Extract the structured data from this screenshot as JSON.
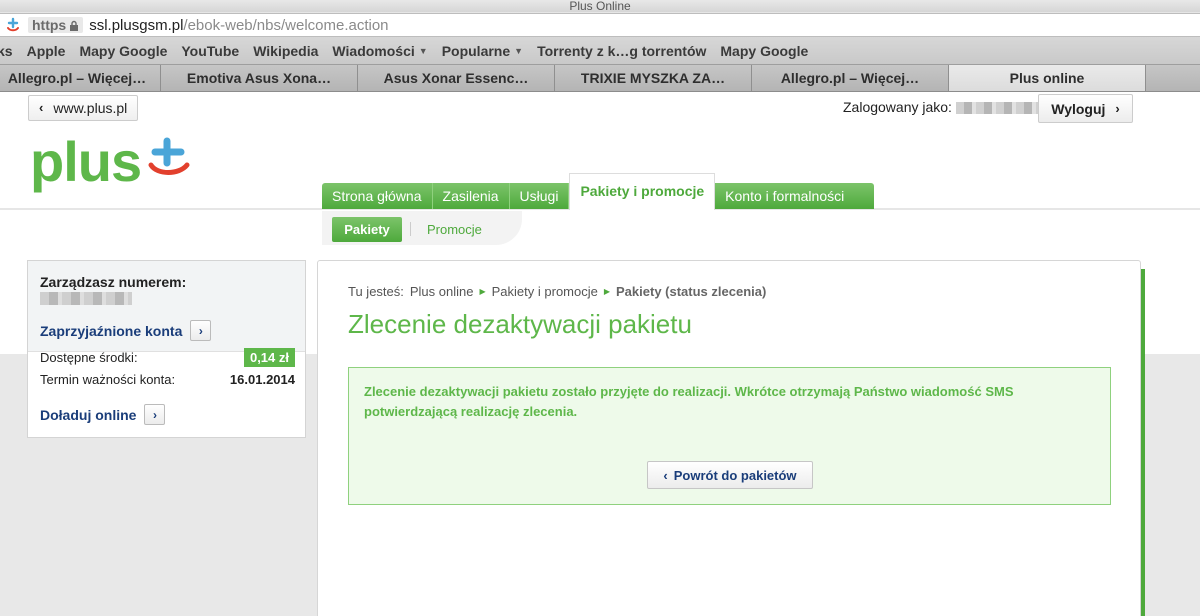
{
  "browser": {
    "title": "Plus Online",
    "url_scheme": "https",
    "url_host": "ssl.plusgsm.pl",
    "url_path": "/ebok-web/nbs/welcome.action",
    "bookmarks": [
      "ks",
      "Apple",
      "Mapy Google",
      "YouTube",
      "Wikipedia",
      "Wiadomości",
      "Popularne",
      "Torrenty z k…g torrentów",
      "Mapy Google"
    ],
    "tabs": [
      {
        "label": "Allegro.pl – Więcej…",
        "active": false
      },
      {
        "label": "Emotiva Asus Xona…",
        "active": false
      },
      {
        "label": "Asus Xonar Essenc…",
        "active": false
      },
      {
        "label": "TRIXIE MYSZKA ZA…",
        "active": false
      },
      {
        "label": "Allegro.pl – Więcej…",
        "active": false
      },
      {
        "label": "Plus online",
        "active": true
      }
    ]
  },
  "header": {
    "back_link": "www.plus.pl",
    "logged_as": "Zalogowany jako:",
    "logout": "Wyloguj",
    "logo": "plus"
  },
  "nav": {
    "main": [
      "Strona główna",
      "Zasilenia",
      "Usługi",
      "Pakiety i promocje",
      "Konto i formalności"
    ],
    "active": "Pakiety i promocje",
    "sub": [
      "Pakiety",
      "Promocje"
    ]
  },
  "sidebar": {
    "title": "Zarządzasz numerem:",
    "friends_link": "Zaprzyjaźnione konta",
    "funds_label": "Dostępne środki:",
    "funds_value": "0,14 zł",
    "validity_label": "Termin ważności konta:",
    "validity_value": "16.01.2014",
    "topup_link": "Doładuj online"
  },
  "main": {
    "breadcrumb_prefix": "Tu jesteś:",
    "breadcrumb": [
      "Plus online",
      "Pakiety i promocje",
      "Pakiety (status zlecenia)"
    ],
    "heading": "Zlecenie dezaktywacji pakietu",
    "message": "Zlecenie dezaktywacji pakietu zostało przyjęte do realizacji. Wkrótce otrzymają Państwo wiadomość SMS potwierdzającą realizację zlecenia.",
    "return_button": "Powrót do pakietów"
  },
  "colors": {
    "brand_green": "#5eb74a",
    "link_blue": "#1a3d7a"
  }
}
